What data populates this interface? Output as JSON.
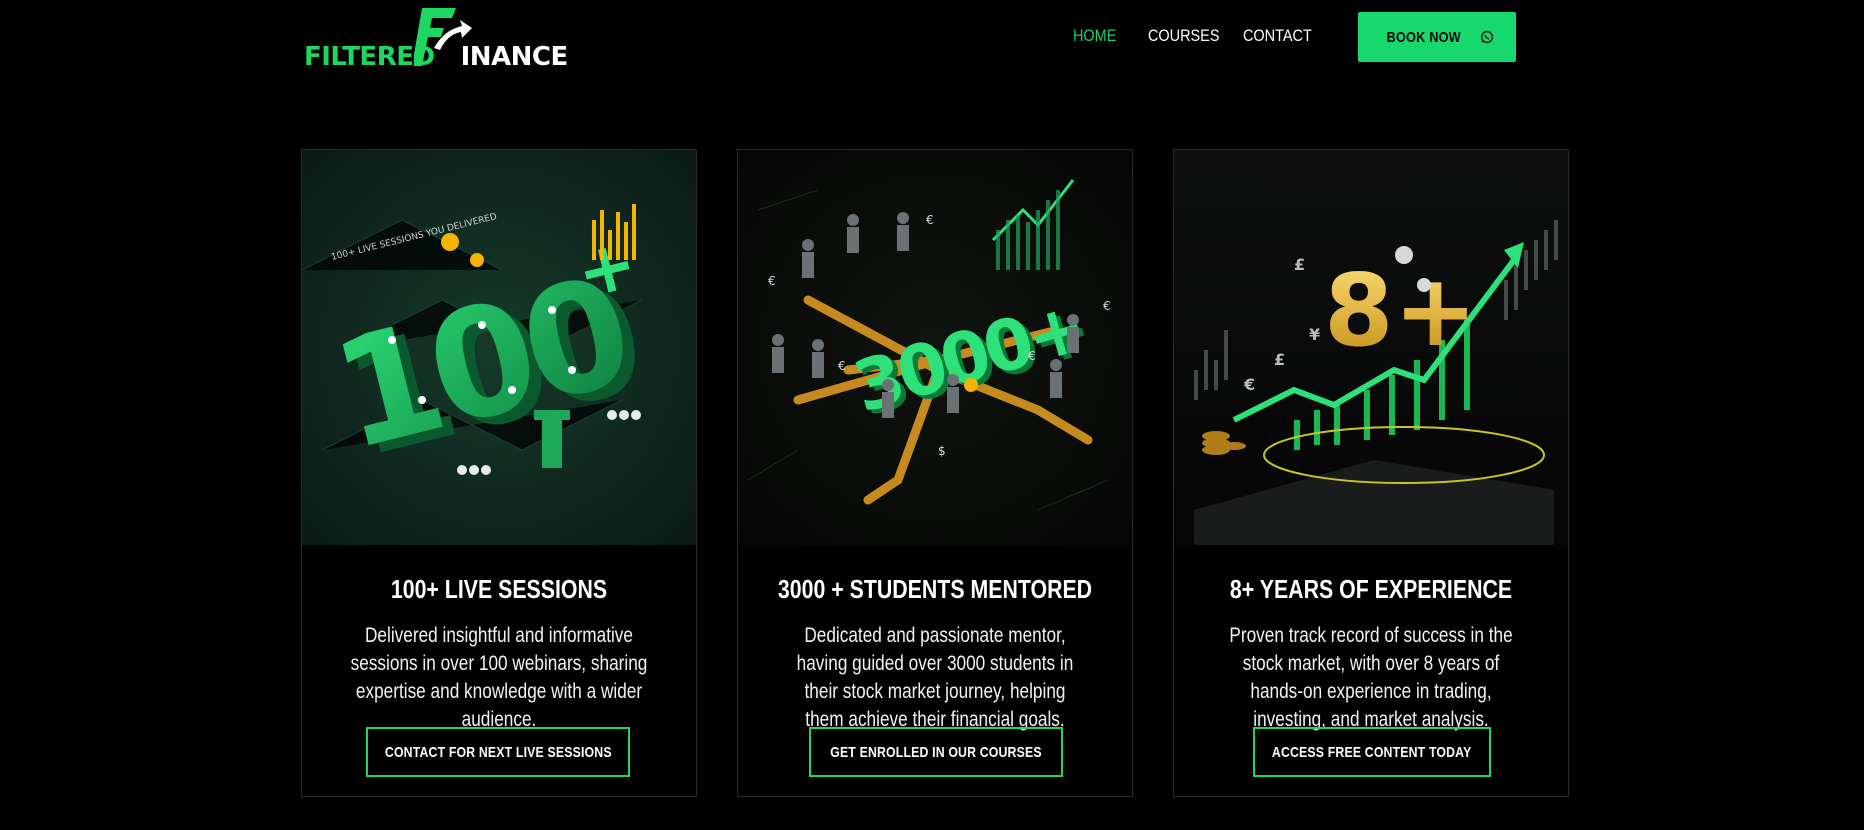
{
  "brand": {
    "logo_left": "FILTERED",
    "logo_right": "INANCE",
    "accent_color": "#1ed760",
    "button_color": "#16d86c"
  },
  "nav": {
    "items": [
      {
        "label": "HOME",
        "active": true
      },
      {
        "label": "COURSES",
        "active": false
      },
      {
        "label": "CONTACT",
        "active": false
      }
    ],
    "book_label": "BOOK NOW",
    "book_icon": "whatsapp-icon"
  },
  "cards": [
    {
      "art_text": "100+",
      "art_caption": "100+ LIVE SESSIONS YOU DELIVERED",
      "title": "100+ LIVE SESSIONS",
      "description": "Delivered insightful and informative sessions in over 100 webinars, sharing expertise and knowledge with a wider audience.",
      "cta": "CONTACT FOR NEXT LIVE SESSIONS"
    },
    {
      "art_text": "3000+",
      "title": "3000 + STUDENTS MENTORED",
      "description": "Dedicated and passionate mentor, having guided over 3000 students in their stock market journey, helping them achieve their financial goals.",
      "cta": "GET ENROLLED IN OUR COURSES"
    },
    {
      "art_text": "8+",
      "title": "8+ YEARS OF EXPERIENCE",
      "description": "Proven track record of success in the stock market, with over 8 years of hands-on experience in trading, investing, and market analysis.",
      "cta": "ACCESS FREE CONTENT TODAY"
    }
  ]
}
